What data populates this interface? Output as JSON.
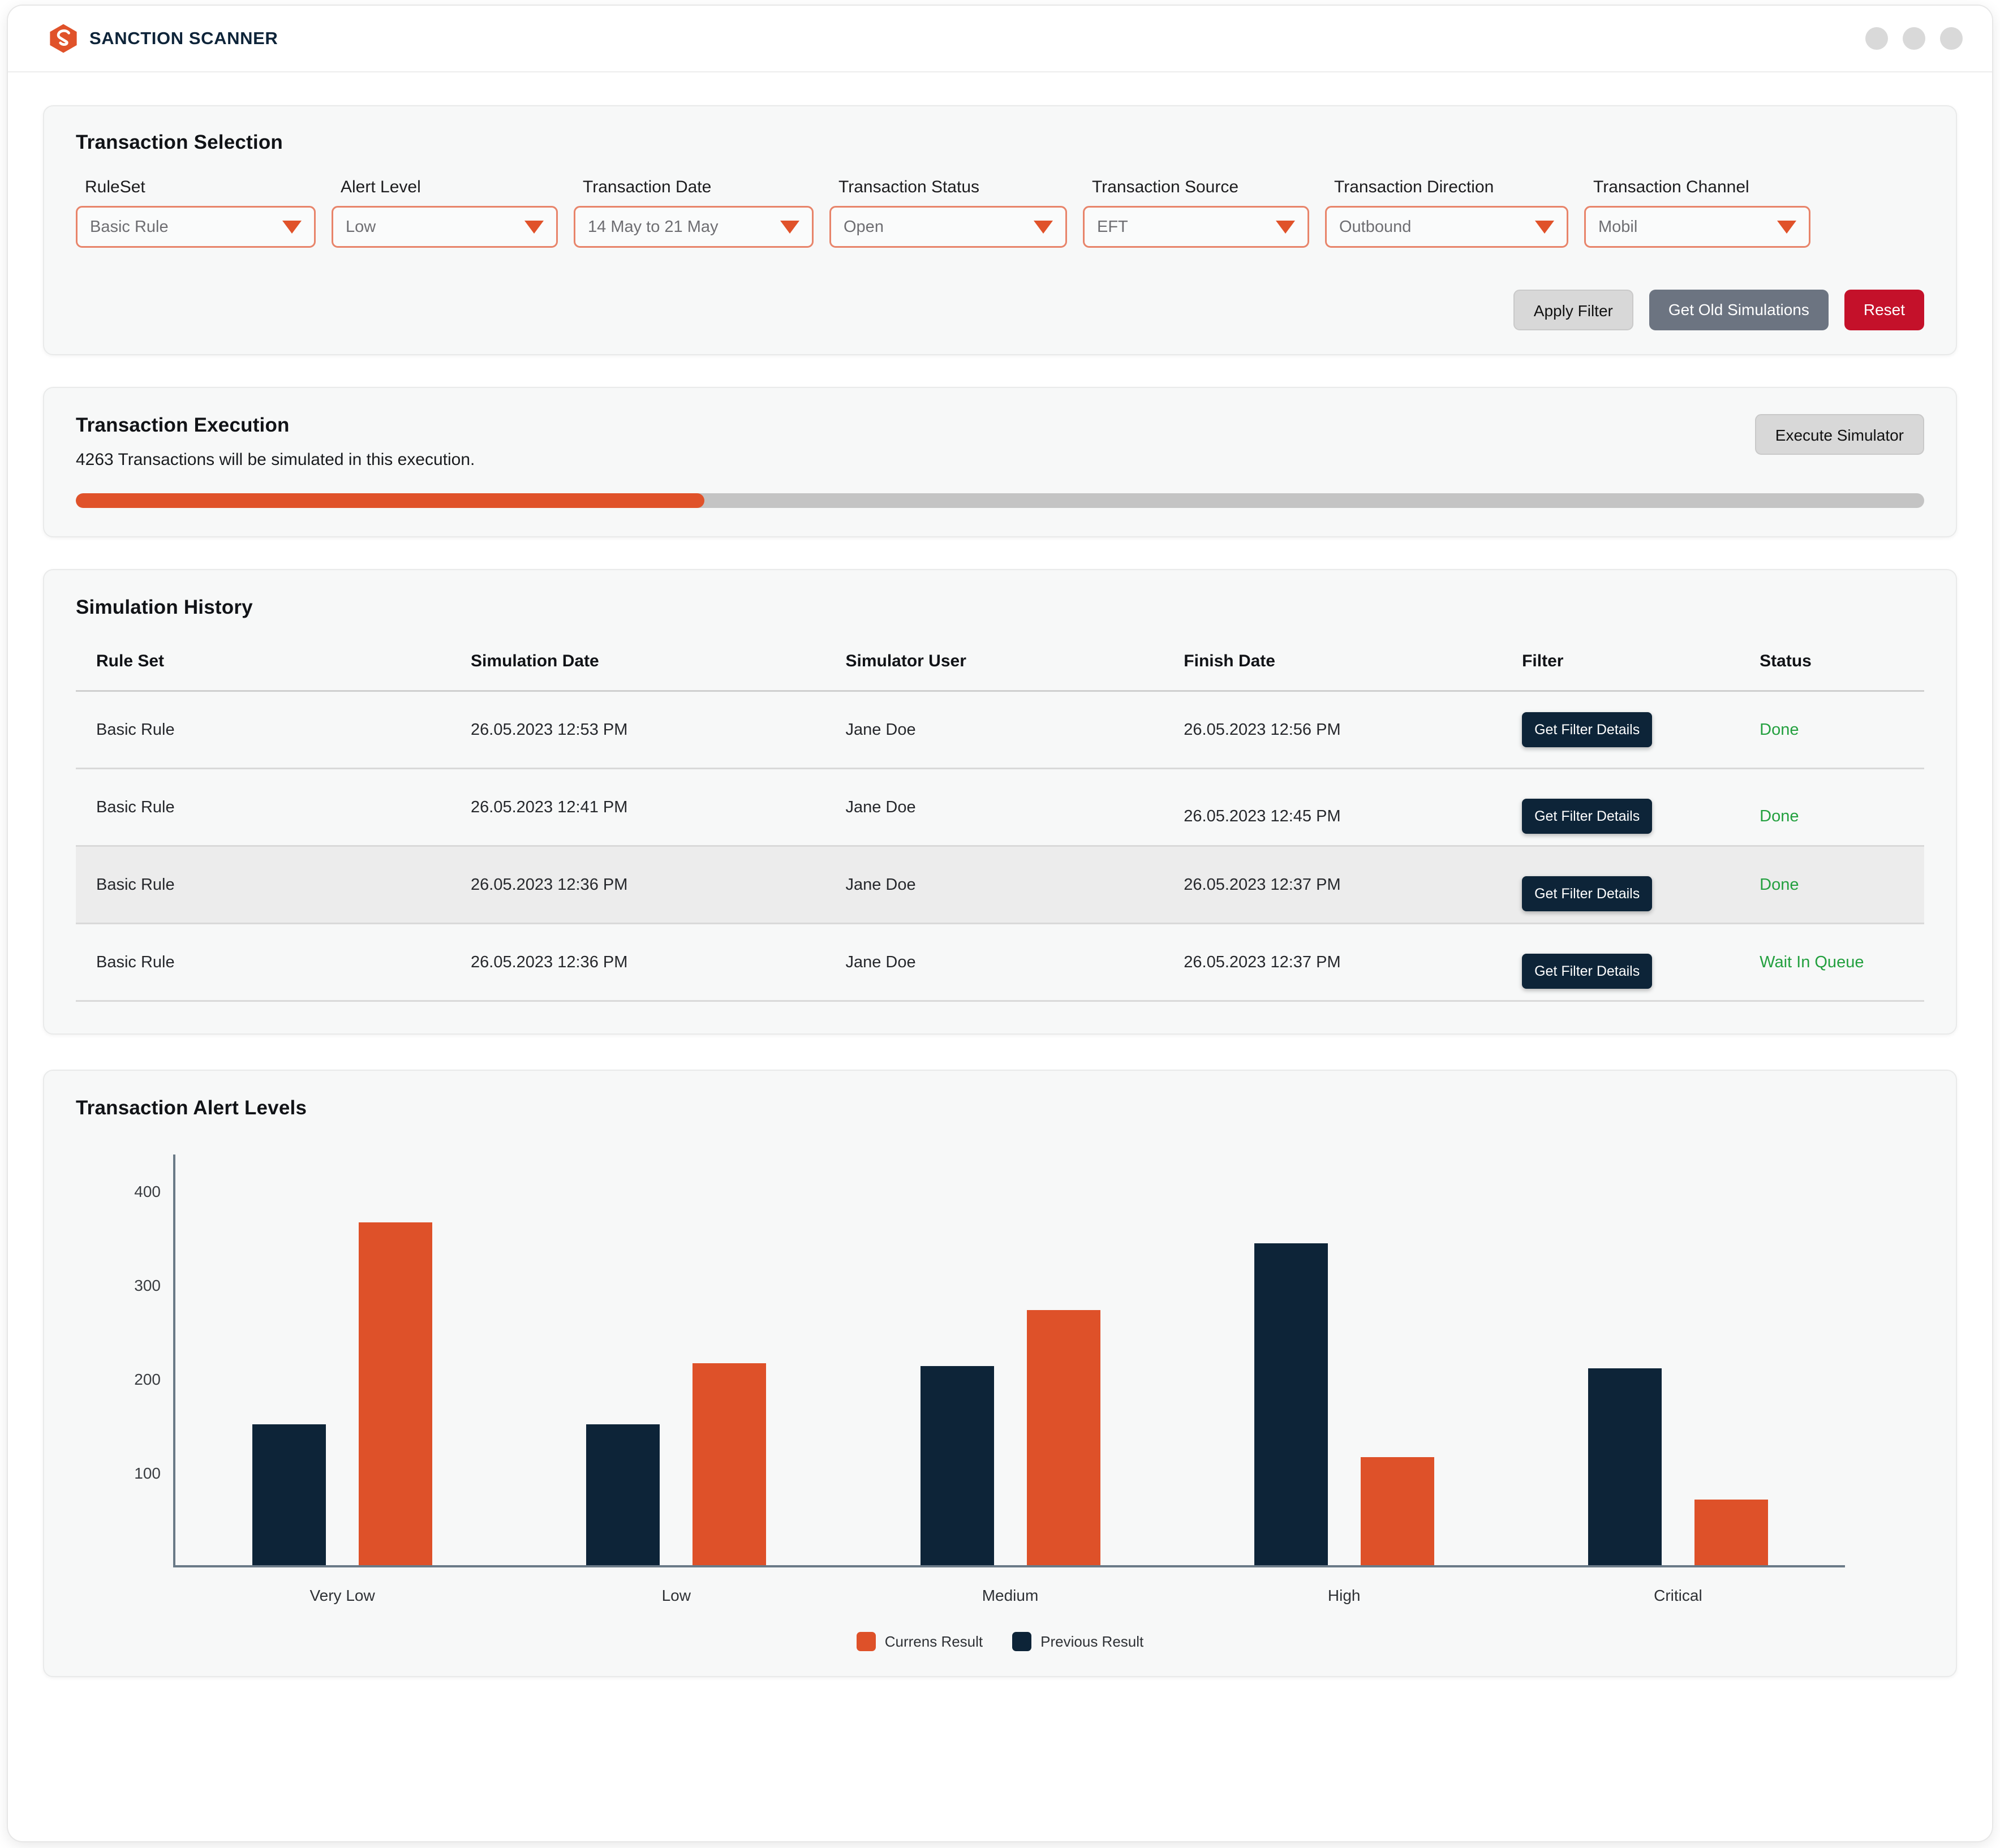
{
  "titlebar": {
    "brand_name": "SANCTION SCANNER",
    "logo_color": "#e0522a",
    "brand_text_color": "#0e2439",
    "window_dots": 3
  },
  "selection": {
    "title": "Transaction Selection",
    "filters": [
      {
        "label": "RuleSet",
        "value": "Basic Rule"
      },
      {
        "label": "Alert Level",
        "value": "Low"
      },
      {
        "label": "Transaction Date",
        "value": "14 May to 21 May"
      },
      {
        "label": "Transaction Status",
        "value": "Open"
      },
      {
        "label": "Transaction Source",
        "value": "EFT"
      },
      {
        "label": "Transaction Direction",
        "value": "Outbound"
      },
      {
        "label": "Transaction Channel",
        "value": "Mobil"
      }
    ],
    "buttons": {
      "apply_filter": "Apply Filter",
      "get_old_simulations": "Get Old Simulations",
      "reset": "Reset"
    }
  },
  "execution": {
    "title": "Transaction Execution",
    "subtitle": "4263 Transactions will be simulated in this execution.",
    "execute_button": "Execute Simulator",
    "progress_percent": 34,
    "progress_color": "#e0522a"
  },
  "history": {
    "title": "Simulation History",
    "columns": [
      "Rule Set",
      "Simulation Date",
      "Simulator User",
      "Finish Date",
      "Filter",
      "Status"
    ],
    "filter_button_label": "Get Filter Details",
    "rows": [
      {
        "rule_set": "Basic Rule",
        "simulation_date": "26.05.2023 12:53 PM",
        "simulator_user": "Jane Doe",
        "finish_date": "26.05.2023 12:56 PM",
        "filter": "Get Filter Details",
        "status": "Done"
      },
      {
        "rule_set": "Basic Rule",
        "simulation_date": "26.05.2023 12:41 PM",
        "simulator_user": "Jane Doe",
        "finish_date": "26.05.2023 12:45 PM",
        "filter": "Get Filter Details",
        "status": "Done"
      },
      {
        "rule_set": "Basic Rule",
        "simulation_date": "26.05.2023 12:36 PM",
        "simulator_user": "Jane Doe",
        "finish_date": "26.05.2023 12:37 PM",
        "filter": "Get Filter Details",
        "status": "Done"
      },
      {
        "rule_set": "Basic Rule",
        "simulation_date": "26.05.2023 12:36 PM",
        "simulator_user": "Jane Doe",
        "finish_date": "26.05.2023 12:37 PM",
        "filter": "Get Filter Details",
        "status": "Wait In Queue"
      }
    ],
    "status_color": "#23a03f"
  },
  "chart_panel": {
    "title": "Transaction Alert Levels"
  },
  "chart_data": {
    "type": "bar",
    "title": "Transaction Alert Levels",
    "categories": [
      "Very Low",
      "Low",
      "Medium",
      "High",
      "Critical"
    ],
    "series": [
      {
        "name": "Previous Result",
        "color": "#0d2438",
        "values": [
          150,
          150,
          212,
          343,
          210
        ]
      },
      {
        "name": "Currens Result",
        "color": "#de5129",
        "values": [
          365,
          215,
          272,
          115,
          70
        ]
      }
    ],
    "legend": [
      "Currens Result",
      "Previous Result"
    ],
    "legend_position": "bottom",
    "xlabel": "",
    "ylabel": "",
    "yticks": [
      100,
      200,
      300,
      400
    ],
    "ylim": [
      0,
      440
    ],
    "grid": false,
    "bar_order": [
      "Previous Result",
      "Currens Result"
    ]
  }
}
